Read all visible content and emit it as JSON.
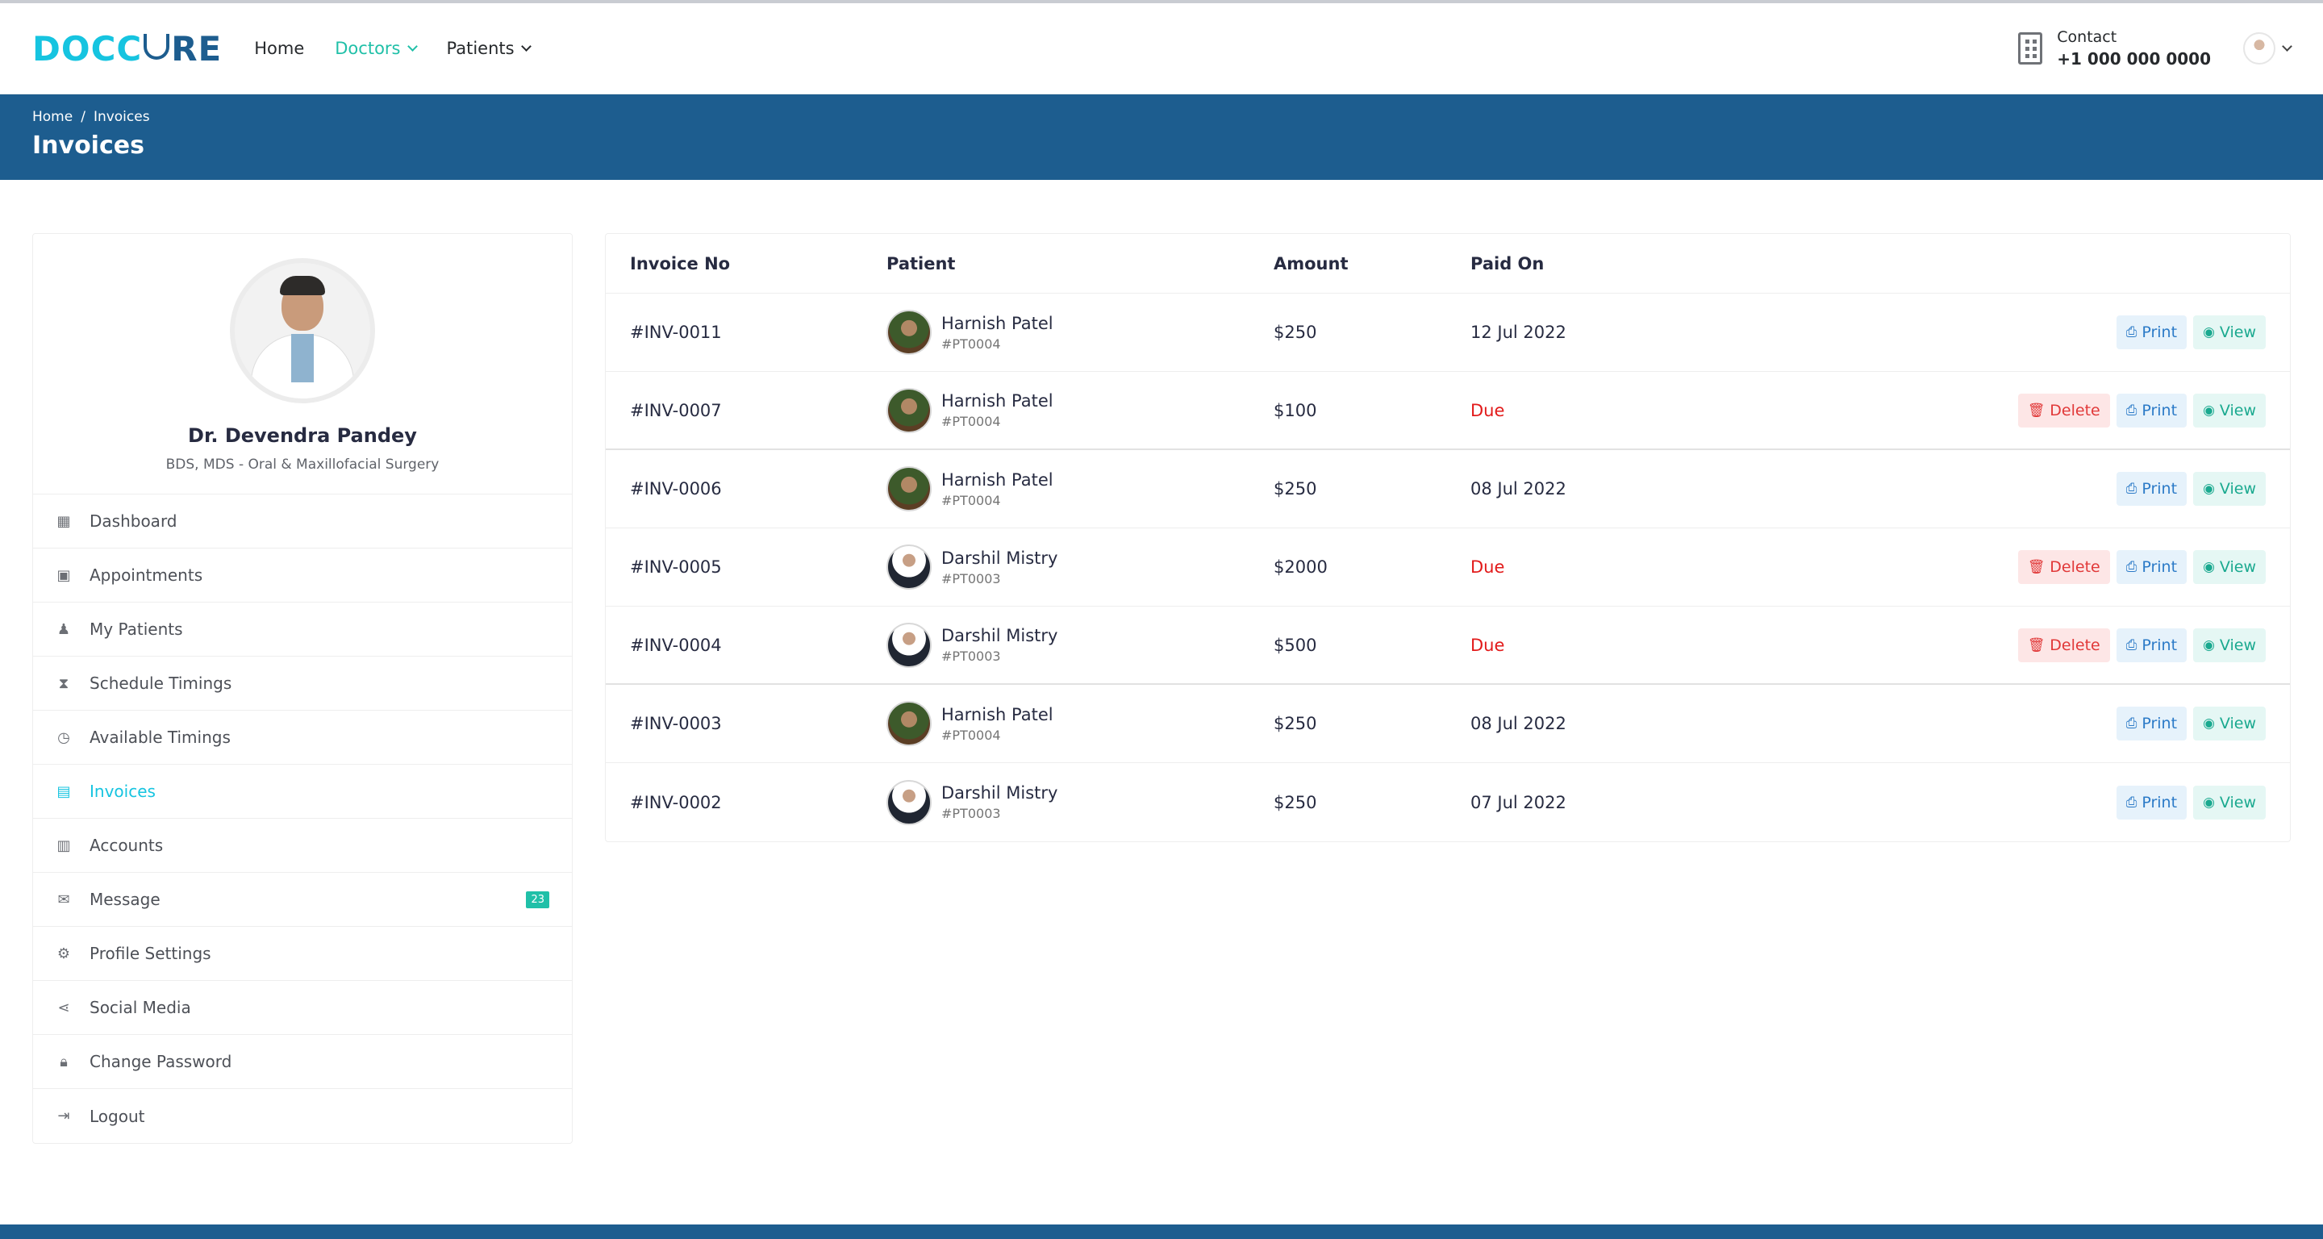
{
  "header": {
    "logo_left": "DOCC",
    "logo_right": "RE",
    "nav": [
      {
        "label": "Home"
      },
      {
        "label": "Doctors"
      },
      {
        "label": "Patients"
      }
    ],
    "contact_label": "Contact",
    "contact_phone": "+1 000 000 0000"
  },
  "banner": {
    "crumb_home": "Home",
    "crumb_sep": "/",
    "crumb_current": "Invoices",
    "title": "Invoices"
  },
  "sidebar": {
    "doctor_name": "Dr. Devendra Pandey",
    "doctor_specialty": "BDS, MDS - Oral & Maxillofacial Surgery",
    "items": [
      {
        "label": "Dashboard",
        "icon": "dashboard-icon"
      },
      {
        "label": "Appointments",
        "icon": "calendar-icon"
      },
      {
        "label": "My Patients",
        "icon": "patients-icon"
      },
      {
        "label": "Schedule Timings",
        "icon": "hourglass-icon"
      },
      {
        "label": "Available Timings",
        "icon": "clock-icon"
      },
      {
        "label": "Invoices",
        "icon": "invoice-icon"
      },
      {
        "label": "Accounts",
        "icon": "accounts-icon"
      },
      {
        "label": "Message",
        "icon": "message-icon",
        "badge": "23"
      },
      {
        "label": "Profile Settings",
        "icon": "user-cog-icon"
      },
      {
        "label": "Social Media",
        "icon": "share-icon"
      },
      {
        "label": "Change Password",
        "icon": "lock-icon"
      },
      {
        "label": "Logout",
        "icon": "logout-icon"
      }
    ]
  },
  "table": {
    "headers": {
      "invoice": "Invoice No",
      "patient": "Patient",
      "amount": "Amount",
      "paid": "Paid On"
    },
    "buttons": {
      "print": "Print",
      "view": "View",
      "delete": "Delete"
    },
    "rows": [
      {
        "invoice": "#INV-0011",
        "patient": "Harnish Patel",
        "pid": "#PT0004",
        "amount": "$250",
        "paid": "12 Jul 2022"
      },
      {
        "invoice": "#INV-0007",
        "patient": "Harnish Patel",
        "pid": "#PT0004",
        "amount": "$100",
        "paid": "Due"
      },
      {
        "invoice": "#INV-0006",
        "patient": "Harnish Patel",
        "pid": "#PT0004",
        "amount": "$250",
        "paid": "08 Jul 2022"
      },
      {
        "invoice": "#INV-0005",
        "patient": "Darshil Mistry",
        "pid": "#PT0003",
        "amount": "$2000",
        "paid": "Due"
      },
      {
        "invoice": "#INV-0004",
        "patient": "Darshil Mistry",
        "pid": "#PT0003",
        "amount": "$500",
        "paid": "Due"
      },
      {
        "invoice": "#INV-0003",
        "patient": "Harnish Patel",
        "pid": "#PT0004",
        "amount": "$250",
        "paid": "08 Jul 2022"
      },
      {
        "invoice": "#INV-0002",
        "patient": "Darshil Mistry",
        "pid": "#PT0003",
        "amount": "$250",
        "paid": "07 Jul 2022"
      }
    ]
  },
  "colors": {
    "brand": "#1d5d8f",
    "accent": "#16c4e0",
    "nav_active": "#20c0a8",
    "due": "#e21a1a"
  }
}
